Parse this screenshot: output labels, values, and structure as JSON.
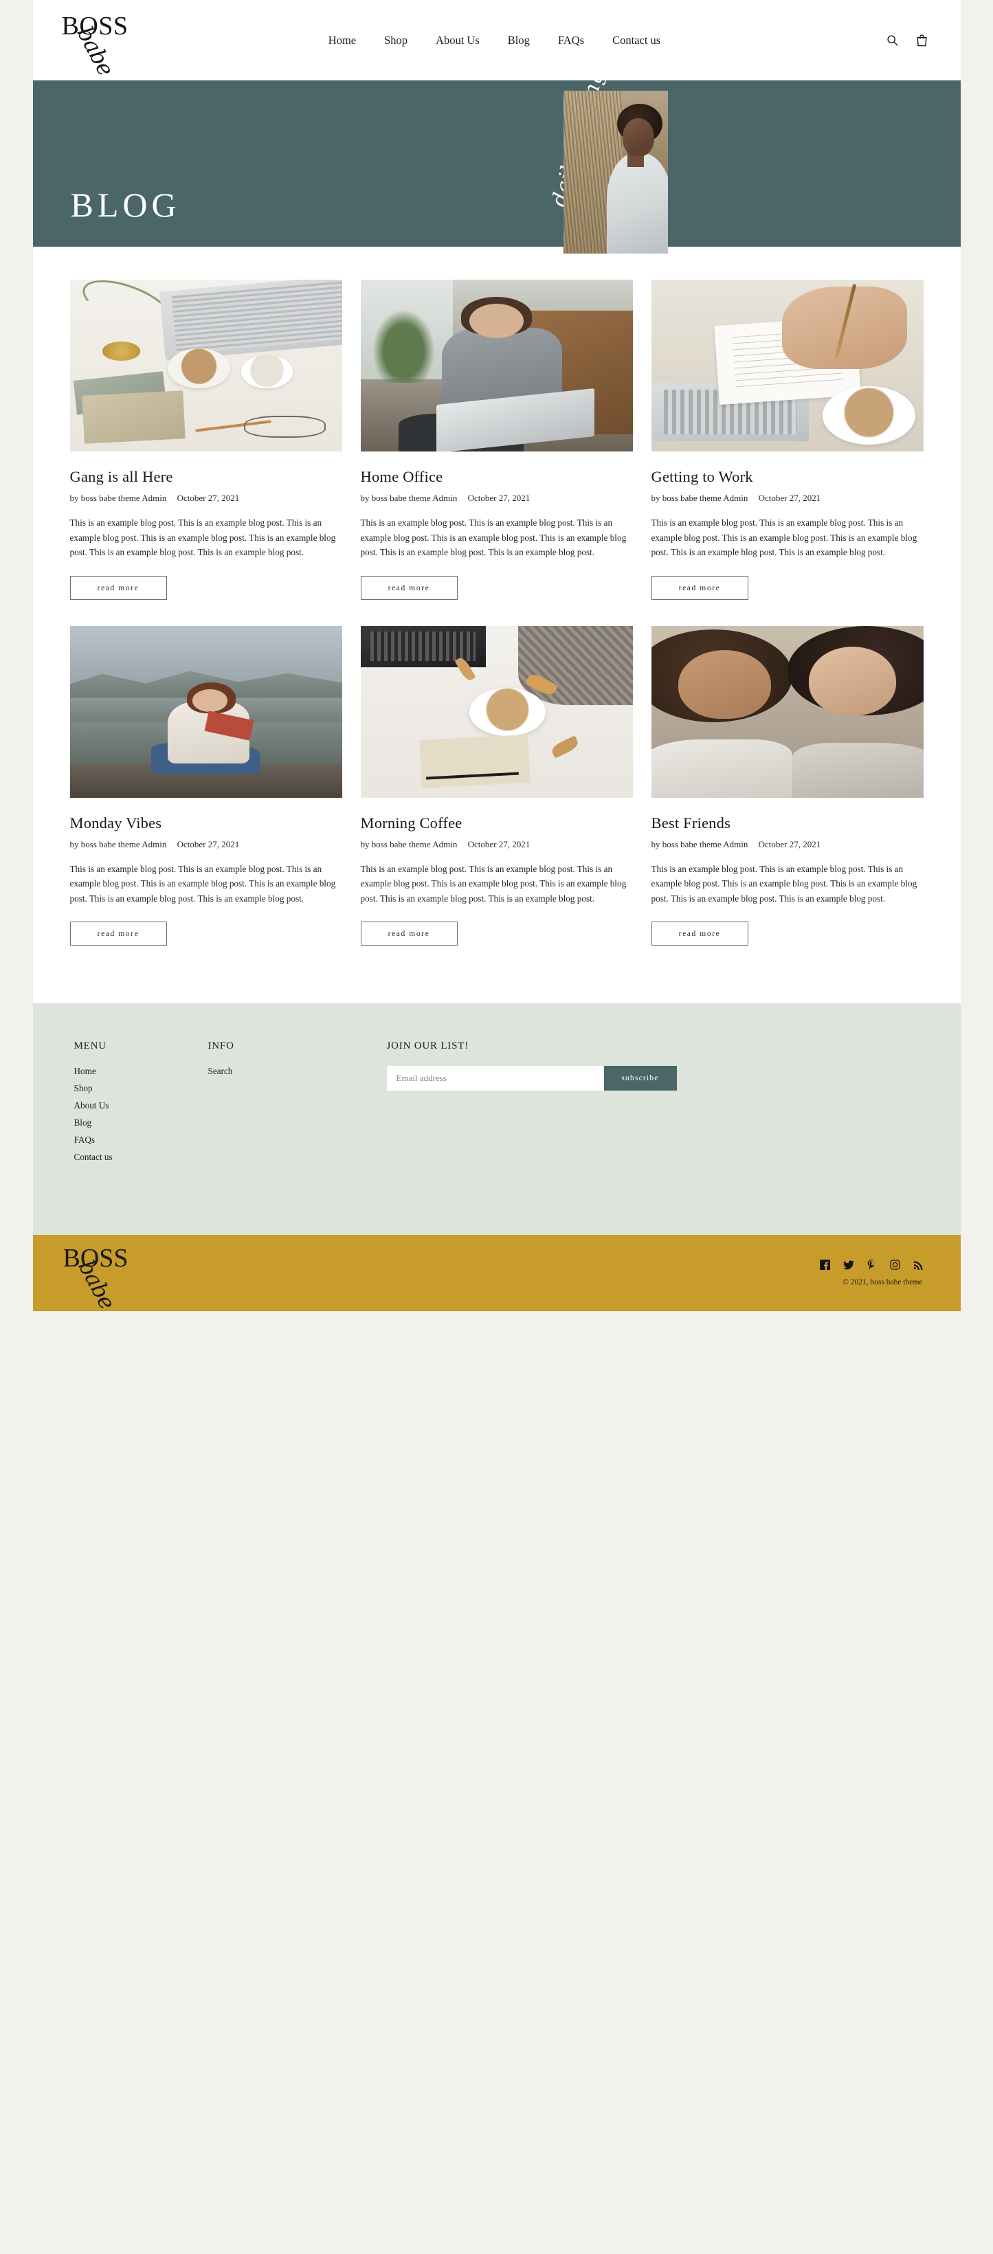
{
  "site": {
    "logo_primary": "BOSS",
    "logo_script": "babe",
    "background_color": "#f2f1ec"
  },
  "header": {
    "nav": [
      {
        "label": "Home"
      },
      {
        "label": "Shop"
      },
      {
        "label": "About Us"
      },
      {
        "label": "Blog"
      },
      {
        "label": "FAQs"
      },
      {
        "label": "Contact us"
      }
    ],
    "icons": [
      {
        "name": "search-icon"
      },
      {
        "name": "cart-icon"
      }
    ]
  },
  "hero": {
    "title": "BLOG",
    "script_text": "daily musings",
    "background_color": "#4a6668",
    "text_color": "#ffffff"
  },
  "posts": [
    {
      "title": "Gang is all Here",
      "author": "by boss babe theme Admin",
      "date": "October 27, 2021",
      "excerpt": "This is an example blog post. This is an example blog post.  This is an example blog post.  This is an example blog post.  This is an example blog post.  This is an example blog post.  This is an example blog post.",
      "read_more": "read more"
    },
    {
      "title": "Home Office",
      "author": "by boss babe theme Admin",
      "date": "October 27, 2021",
      "excerpt": "This is an example blog post. This is an example blog post.  This is an example blog post.  This is an example blog post.  This is an example blog post.  This is an example blog post.  This is an example blog post.",
      "read_more": "read more"
    },
    {
      "title": "Getting to Work",
      "author": "by boss babe theme Admin",
      "date": "October 27, 2021",
      "excerpt": "This is an example blog post. This is an example blog post.  This is an example blog post.  This is an example blog post.  This is an example blog post.  This is an example blog post.  This is an example blog post.",
      "read_more": "read more"
    },
    {
      "title": "Monday Vibes",
      "author": "by boss babe theme Admin",
      "date": "October 27, 2021",
      "excerpt": "This is an example blog post. This is an example blog post.  This is an example blog post.  This is an example blog post.  This is an example blog post.  This is an example blog post.  This is an example blog post.",
      "read_more": "read more"
    },
    {
      "title": "Morning Coffee",
      "author": "by boss babe theme Admin",
      "date": "October 27, 2021",
      "excerpt": "This is an example blog post. This is an example blog post.  This is an example blog post.  This is an example blog post.  This is an example blog post.  This is an example blog post.  This is an example blog post.",
      "read_more": "read more"
    },
    {
      "title": "Best Friends",
      "author": "by boss babe theme Admin",
      "date": "October 27, 2021",
      "excerpt": "This is an example blog post. This is an example blog post.  This is an example blog post.  This is an example blog post.  This is an example blog post.  This is an example blog post.  This is an example blog post.",
      "read_more": "read more"
    }
  ],
  "footer": {
    "background_color": "#dde4dc",
    "menu_heading": "MENU",
    "menu_links": [
      {
        "label": "Home"
      },
      {
        "label": "Shop"
      },
      {
        "label": "About Us"
      },
      {
        "label": "Blog"
      },
      {
        "label": "FAQs"
      },
      {
        "label": "Contact us"
      }
    ],
    "info_heading": "INFO",
    "info_links": [
      {
        "label": "Search"
      }
    ],
    "list_heading": "JOIN OUR LIST!",
    "email_placeholder": "Email address",
    "email_value": "",
    "subscribe_label": "subscribe",
    "subscribe_color": "#4a6668"
  },
  "bottom_bar": {
    "background_color": "#c79c2b",
    "logo_primary": "BOSS",
    "logo_script": "babe",
    "copyright": "© 2021, boss babe theme",
    "socials": [
      {
        "name": "facebook-icon"
      },
      {
        "name": "twitter-icon"
      },
      {
        "name": "pinterest-icon"
      },
      {
        "name": "instagram-icon"
      },
      {
        "name": "rss-icon"
      }
    ]
  }
}
